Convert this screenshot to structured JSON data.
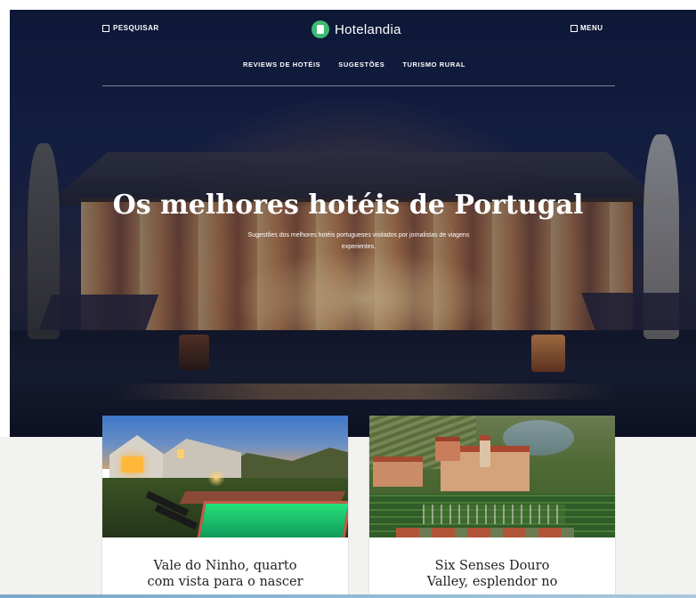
{
  "header": {
    "search_label": "PESQUISAR",
    "brand": "Hotelandia",
    "menu_label": "MENU",
    "nav": [
      "REVIEWS DE HOTÉIS",
      "SUGESTÕES",
      "TURISMO RURAL"
    ]
  },
  "hero": {
    "title": "Os melhores hotéis de Portugal",
    "subtitle": "Sugestões dos melhores hotéis portugueses visitados por jornalistas de viagens experientes."
  },
  "cards": [
    {
      "title_line1": "Vale do Ninho, quarto",
      "title_line2": "com vista para o nascer"
    },
    {
      "title_line1": "Six Senses Douro",
      "title_line2": "Valley, esplendor no"
    }
  ],
  "icons": {
    "search": "square-outline-icon",
    "menu": "square-outline-icon",
    "logo": "padlock-logo-icon"
  },
  "colors": {
    "brand_green": "#3dbb73",
    "hero_text": "#ffffff",
    "section_bg": "#f2f2f0"
  }
}
